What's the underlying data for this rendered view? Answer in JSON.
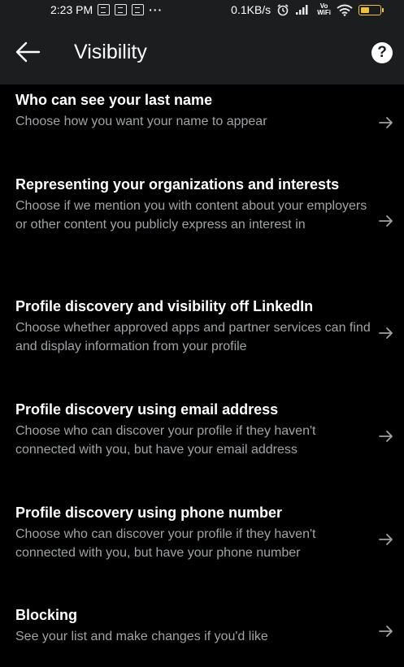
{
  "status_bar": {
    "time": "2:23 PM",
    "more": "···",
    "speed": "0.1KB/s",
    "volte": [
      "Vo",
      "WiFi"
    ]
  },
  "header": {
    "title": "Visibility",
    "help_glyph": "?"
  },
  "icons": {
    "back": "arrow-left-icon",
    "help": "help-circle-icon",
    "item_arrow": "arrow-right-icon"
  },
  "colors": {
    "background": "#000000",
    "header_bg": "#1b1d1f",
    "title_text": "#ffffff",
    "secondary_text": "#a0a3a6",
    "battery": "#f0c040"
  },
  "items": [
    {
      "title": "Who can see your last name",
      "description": "Choose how you want your name to appear"
    },
    {
      "title": "Representing your organizations and interests",
      "description": "Choose if we mention you with content about your employers or other content you publicly express an interest in"
    },
    {
      "title": "Profile discovery and visibility off LinkedIn",
      "description": "Choose whether approved apps and partner services can find and display information from your profile"
    },
    {
      "title": "Profile discovery using email address",
      "description": "Choose who can discover your profile if they haven't connected with you, but have your email address"
    },
    {
      "title": "Profile discovery using phone number",
      "description": "Choose who can discover your profile if they haven't connected with you, but have your phone number"
    },
    {
      "title": "Blocking",
      "description": "See your list and make changes if you'd like"
    }
  ]
}
